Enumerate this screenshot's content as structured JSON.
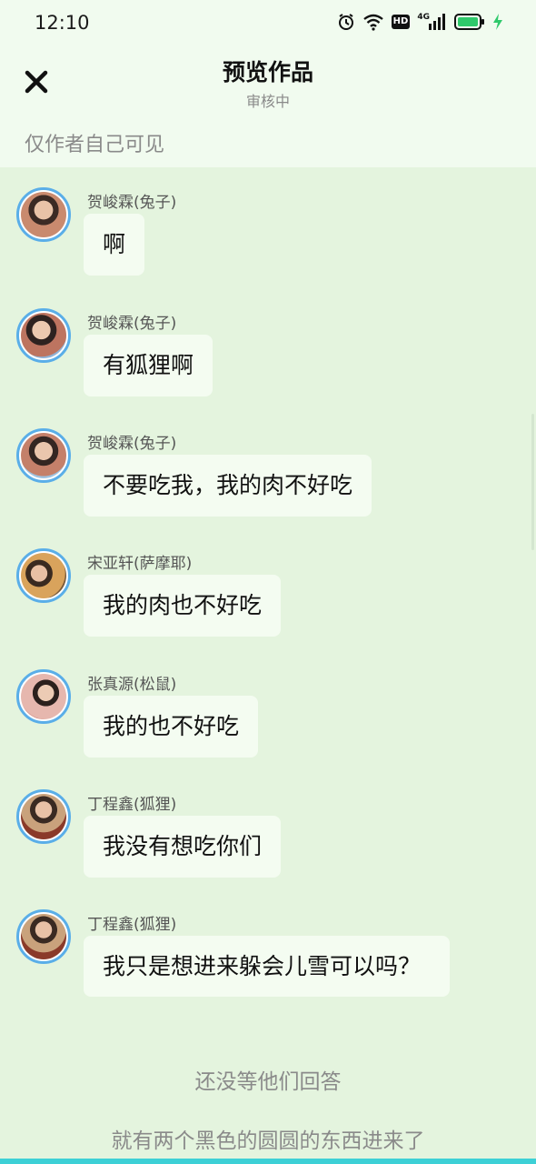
{
  "status_bar": {
    "time": "12:10",
    "hd_label": "HD",
    "network_label": "4G",
    "icons": [
      "alarm-icon",
      "wifi-icon",
      "hd-icon",
      "signal-icon",
      "battery-icon",
      "charging-icon"
    ]
  },
  "header": {
    "close_icon": "close-icon",
    "title": "预览作品",
    "subtitle": "审核中",
    "visibility_note": "仅作者自己可见"
  },
  "messages": [
    {
      "sender": "贺峻霖(兔子)",
      "text": "啊"
    },
    {
      "sender": "贺峻霖(兔子)",
      "text": "有狐狸啊"
    },
    {
      "sender": "贺峻霖(兔子)",
      "text": "不要吃我，我的肉不好吃"
    },
    {
      "sender": "宋亚轩(萨摩耶)",
      "text": "我的肉也不好吃"
    },
    {
      "sender": "张真源(松鼠)",
      "text": "我的也不好吃"
    },
    {
      "sender": "丁程鑫(狐狸)",
      "text": "我没有想吃你们"
    },
    {
      "sender": "丁程鑫(狐狸)",
      "text": "我只是想进来躲会儿雪可以吗？"
    }
  ],
  "narrations": [
    "还没等他们回答",
    "就有两个黑色的圆圆的东西进来了"
  ],
  "colors": {
    "background": "#e4f4de",
    "header_bg": "#f1fbef",
    "bubble_bg": "#f4fcf1",
    "avatar_ring": "#5aaee8",
    "battery": "#2fc96b",
    "bottom_strip": "#3dd0d6"
  }
}
